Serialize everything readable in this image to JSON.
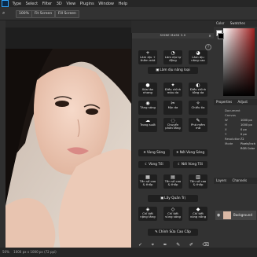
{
  "menubar": {
    "items": [
      "Type",
      "Select",
      "Filter",
      "3D",
      "View",
      "Plugins",
      "Window",
      "Help"
    ]
  },
  "options_bar": {
    "zoom_value": "100%",
    "fit_screen": "Fit Screen",
    "fill_screen": "Fill Screen"
  },
  "statusbar": {
    "zoom": "50%",
    "doc_info": "1000 px x 1000 px (72 ppi)"
  },
  "panel": {
    "title": "SHINE MASK 3.0",
    "close": "✕",
    "help": "?",
    "tiles_row1": [
      {
        "icon": "+",
        "label": "Làm dịu + thêm mát"
      },
      {
        "icon": "◔",
        "label": "Làm dịu tự động"
      },
      {
        "icon": "◕",
        "label": "Làm dịu nâng cao"
      }
    ],
    "wide_1": "Làm dịu nâng loại",
    "tiles_row2": [
      {
        "icon": "●",
        "label": "Xóa tàn nhang"
      },
      {
        "icon": "✦",
        "label": "Điều chỉnh màu da"
      },
      {
        "icon": "◐",
        "label": "Điều chỉnh tông da"
      }
    ],
    "tiles_row3": [
      {
        "icon": "◉",
        "label": "Tăng sáng"
      },
      {
        "icon": "✂",
        "label": "Mịn da"
      },
      {
        "icon": "✧",
        "label": "Chiếu tia"
      }
    ],
    "tiles_row4": [
      {
        "icon": "☁",
        "label": "Trong suốt"
      },
      {
        "icon": "◌",
        "label": "Chuyển phân tầng"
      },
      {
        "icon": "✎",
        "label": "Phá mềm mờ"
      }
    ],
    "wide_row_a": [
      "Vùng Sáng",
      "Nới Vùng Sáng"
    ],
    "wide_row_b": [
      "Vùng Tối",
      "Nới Vùng Tối"
    ],
    "tiles_row5": [
      {
        "icon": "▦",
        "label": "Tần số cao & thấp"
      },
      {
        "icon": "▤",
        "label": "Tần số cao & thấp"
      },
      {
        "icon": "▥",
        "label": "Tần số cao & thấp"
      }
    ],
    "wide_2": "Lấy Quản Trị",
    "tiles_row6": [
      {
        "icon": "◈",
        "label": "Chỉ tiết nặng tăng"
      },
      {
        "icon": "◇",
        "label": "Chỉ tiết vùng sáng"
      },
      {
        "icon": "◆",
        "label": "Chỉ tiết vùng nông"
      }
    ],
    "wide_3": "Chỉnh Sửa Cao Cấp",
    "bottom_icons": [
      "✓",
      "⌖",
      "✒",
      "✎",
      "✐",
      "⌫"
    ]
  },
  "right_panels": {
    "color_tabs": [
      "Color",
      "Swatches"
    ],
    "prop_tabs": [
      "Properties",
      "Adjust"
    ],
    "prop_labels": [
      "Document",
      "Canvas",
      "W",
      "H",
      "X",
      "Y",
      "Resolution",
      "Mode"
    ],
    "prop_values": [
      "1000 px",
      "1000 px",
      "0 px",
      "0 px",
      "72 Pixels/Inch",
      "RGB Color"
    ],
    "layers_tabs": [
      "Layers",
      "Channels"
    ],
    "layer_name": "Background"
  }
}
